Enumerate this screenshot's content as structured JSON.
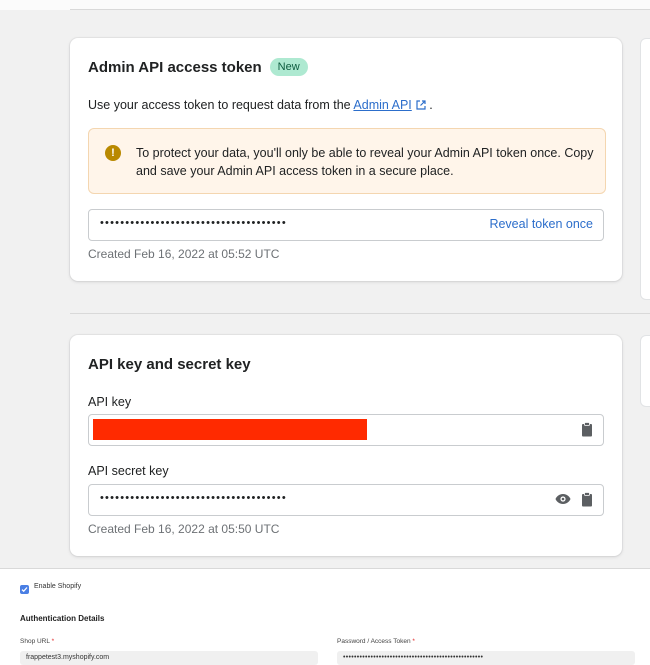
{
  "token_card": {
    "title": "Admin API access token",
    "badge": "New",
    "desc_prefix": "Use your access token to request data from the ",
    "desc_link": "Admin API",
    "desc_suffix": " .",
    "banner_text": "To protect your data, you'll only be able to reveal your Admin API token once. Copy and save your Admin API access token in a secure place.",
    "token_masked": "•••••••••••••••••••••••••••••••••••••",
    "reveal_label": "Reveal token once",
    "created": "Created Feb 16, 2022 at 05:52 UTC"
  },
  "keys_card": {
    "title": "API key and secret key",
    "api_key_label": "API key",
    "secret_label": "API secret key",
    "secret_masked": "•••••••••••••••••••••••••••••••••••••",
    "created": "Created Feb 16, 2022 at 05:50 UTC"
  },
  "settings_panel": {
    "enable_label": "Enable Shopify",
    "enable_checked": true,
    "section_heading": "Authentication Details",
    "shop_url_label": "Shop URL",
    "shop_url_value": "frappetest3.myshopify.com",
    "password_label": "Password / Access Token",
    "password_value": "•••••••••••••••••••••••••••••••••••••••••••••••••••"
  },
  "colors": {
    "link": "#2c6ecb",
    "badge_bg": "#aee9d1",
    "warning_bg": "#fff5ea",
    "redaction": "#ff2a00"
  }
}
